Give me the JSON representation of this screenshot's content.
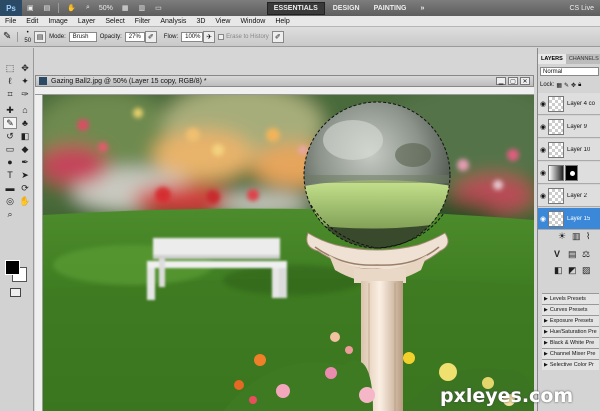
{
  "app": {
    "logo": "Ps",
    "zoom": "50%",
    "workspaces": [
      "ESSENTIALS",
      "DESIGN",
      "PAINTING"
    ],
    "active_workspace": "ESSENTIALS",
    "more": "»",
    "cs_live": "CS Live"
  },
  "menu": [
    "File",
    "Edit",
    "Image",
    "Layer",
    "Select",
    "Filter",
    "Analysis",
    "3D",
    "View",
    "Window",
    "Help"
  ],
  "options": {
    "brush_size": "50",
    "mode_label": "Mode:",
    "mode_value": "Brush",
    "opacity_label": "Opacity:",
    "opacity_value": "27%",
    "flow_label": "Flow:",
    "flow_value": "100%",
    "erase_history": "Erase to History"
  },
  "document": {
    "title": "Gazing Ball2.jpg @ 50% (Layer 15 copy, RGB/8) *"
  },
  "layers_panel": {
    "tabs": [
      "LAYERS",
      "CHANNELS"
    ],
    "blend_mode": "Normal",
    "lock_label": "Lock:",
    "layers": [
      {
        "name": "Layer 4 co",
        "selected": false,
        "type": "normal"
      },
      {
        "name": "Layer 9",
        "selected": false,
        "type": "normal"
      },
      {
        "name": "Layer 10",
        "selected": false,
        "type": "normal"
      },
      {
        "name": "",
        "selected": false,
        "type": "adjustment"
      },
      {
        "name": "Layer 2",
        "selected": false,
        "type": "normal"
      },
      {
        "name": "Layer 15",
        "selected": true,
        "type": "normal"
      }
    ]
  },
  "adjustments_presets": [
    "Levels Presets",
    "Curves Presets",
    "Exposure Presets",
    "Hue/Saturation Pre",
    "Black & White Pre",
    "Channel Mixer Pre",
    "Selective Color Pr"
  ],
  "watermark": "pxleyes.com"
}
